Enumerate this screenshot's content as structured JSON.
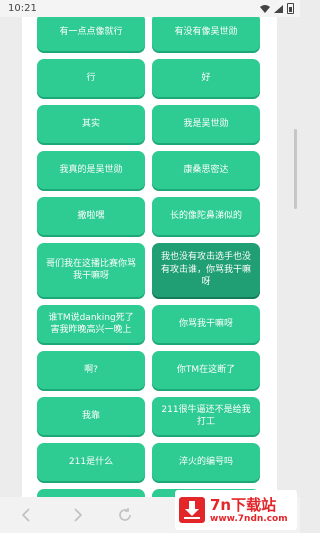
{
  "status_bar": {
    "time": "10:21",
    "icons": [
      "wifi-icon",
      "signal-icon",
      "battery-icon"
    ]
  },
  "buttons": [
    {
      "label": "有一点点像就行"
    },
    {
      "label": "有没有像吴世勋"
    },
    {
      "label": "行"
    },
    {
      "label": "好"
    },
    {
      "label": "其实"
    },
    {
      "label": "我是吴世勋"
    },
    {
      "label": "我真的是吴世勋"
    },
    {
      "label": "康桑思密达"
    },
    {
      "label": "撒啦嘿"
    },
    {
      "label": "长的像陀鼻涕似的"
    },
    {
      "label": "哥们我在这播比赛你骂我干嘛呀"
    },
    {
      "label": "我也没有攻击选手也没有攻击谁，你骂我干嘛呀",
      "active": true
    },
    {
      "label": "谁TM说danking死了害我昨晚高兴一晚上"
    },
    {
      "label": "你骂我干嘛呀"
    },
    {
      "label": "啊?"
    },
    {
      "label": "你TM在这断了"
    },
    {
      "label": "我靠"
    },
    {
      "label": "211很牛逼还不是给我打工"
    },
    {
      "label": "211是什么"
    },
    {
      "label": "淬火的编号吗"
    },
    {
      "label": ""
    },
    {
      "label": ""
    }
  ],
  "nav_bar": {
    "back_icon": "chevron-left-icon",
    "forward_icon": "chevron-right-icon",
    "refresh_icon": "refresh-icon"
  },
  "watermark": {
    "title": "7n下载站",
    "url": "www.7ndn.com",
    "color": "#e3262a"
  },
  "colors": {
    "button": "#2ecb92",
    "button_active": "#1f9f73"
  }
}
